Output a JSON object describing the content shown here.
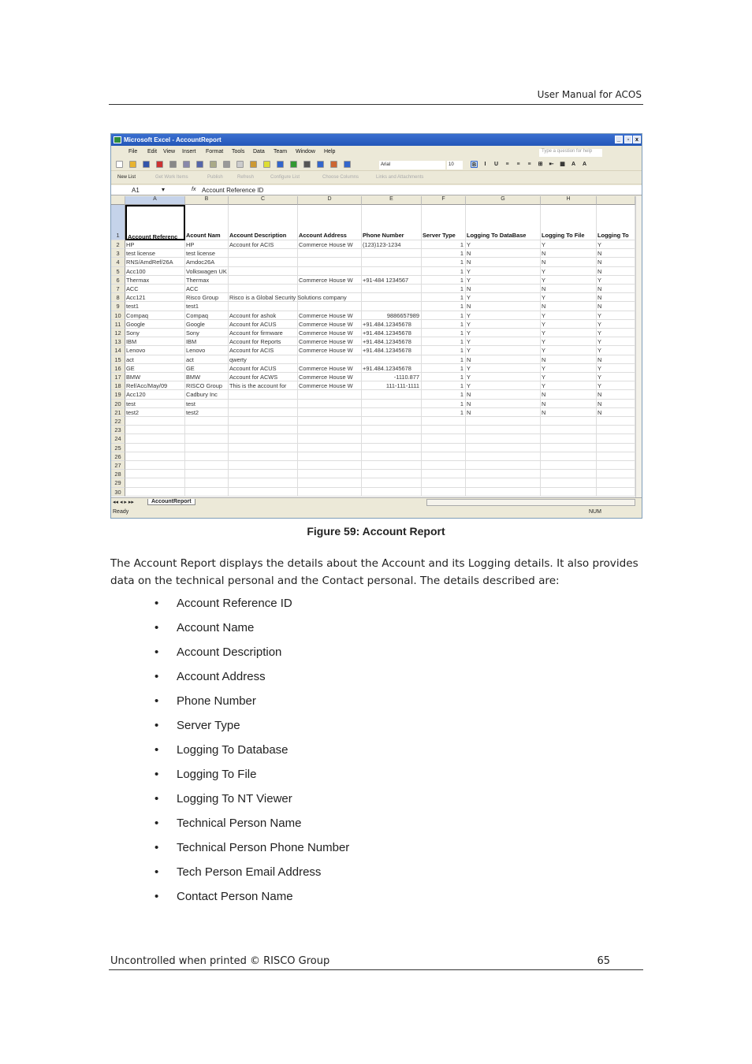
{
  "header": {
    "title": "User Manual for ACOS"
  },
  "excel": {
    "window_title": "Microsoft Excel - AccountReport",
    "window_buttons": [
      "_",
      "▫",
      "x"
    ],
    "menu": [
      "File",
      "Edit",
      "View",
      "Insert",
      "Format",
      "Tools",
      "Data",
      "Team",
      "Window",
      "Help"
    ],
    "help_placeholder": "Type a question for help",
    "font_name": "Arial",
    "font_size": "10",
    "team_toolbar": [
      "New List",
      "Get Work Items",
      "Publish",
      "Refresh",
      "Configure List",
      "Choose Columns",
      "Links and Attachments"
    ],
    "name_box": "A1",
    "formula_icon": "fx",
    "formula_value": "Account Reference ID",
    "columns": [
      "A",
      "B",
      "C",
      "D",
      "E",
      "F",
      "G",
      "H",
      ""
    ],
    "headers": [
      "Account Referenc",
      "Acount Nam",
      "Account Description",
      "Account Address",
      "Phone Number",
      "Server Type",
      "Logging To DataBase",
      "Logging To File",
      "Logging To"
    ],
    "rows": [
      [
        "HP",
        "HP",
        "Account for ACIS",
        "Commerce House W",
        "(123)123-1234",
        "1",
        "Y",
        "Y",
        "Y"
      ],
      [
        "test license",
        "test license",
        "",
        "",
        "",
        "1",
        "N",
        "N",
        "N"
      ],
      [
        "RNS/AmdRef/26A",
        "Amdoc26A",
        "",
        "",
        "",
        "1",
        "N",
        "N",
        "N"
      ],
      [
        "Acc100",
        "Volkswagen UK",
        "",
        "",
        "",
        "1",
        "Y",
        "Y",
        "N"
      ],
      [
        "Thermax",
        "Thermax",
        "",
        "Commerce House W",
        "+91-484 1234567",
        "1",
        "Y",
        "Y",
        "Y"
      ],
      [
        "ACC",
        "ACC",
        "",
        "",
        "",
        "1",
        "N",
        "N",
        "N"
      ],
      [
        "Acc121",
        "Risco Group",
        "Risco is a Global Security Solutions company",
        "",
        "",
        "1",
        "Y",
        "Y",
        "N"
      ],
      [
        "test1",
        "test1",
        "",
        "",
        "",
        "1",
        "N",
        "N",
        "N"
      ],
      [
        "Compaq",
        "Compaq",
        "Account for ashok",
        "Commerce House W",
        "9886657989",
        "1",
        "Y",
        "Y",
        "Y"
      ],
      [
        "Google",
        "Google",
        "Account for ACUS",
        "Commerce House W",
        "+91.484.12345678",
        "1",
        "Y",
        "Y",
        "Y"
      ],
      [
        "Sony",
        "Sony",
        "Account for firmware",
        "Commerce House W",
        "+91.484.12345678",
        "1",
        "Y",
        "Y",
        "Y"
      ],
      [
        "IBM",
        "IBM",
        "Account for Reports",
        "Commerce House W",
        "+91.484.12345678",
        "1",
        "Y",
        "Y",
        "Y"
      ],
      [
        "Lenovo",
        "Lenovo",
        "Account for ACIS",
        "Commerce House W",
        "+91.484.12345678",
        "1",
        "Y",
        "Y",
        "Y"
      ],
      [
        "act",
        "act",
        "qwerty",
        "",
        "",
        "1",
        "N",
        "N",
        "N"
      ],
      [
        "GE",
        "GE",
        "Account for ACUS",
        "Commerce House W",
        "+91.484.12345678",
        "1",
        "Y",
        "Y",
        "Y"
      ],
      [
        "BMW",
        "BMW",
        "Account for ACWS",
        "Commerce House W",
        "-1110.877",
        "1",
        "Y",
        "Y",
        "Y"
      ],
      [
        "Ref/Acc/May/09",
        "RISCO Group",
        "This is the account for",
        "Commerce House W",
        "111-111-1111",
        "1",
        "Y",
        "Y",
        "Y"
      ],
      [
        "Acc120",
        "Cadbury Inc",
        "",
        "",
        "",
        "1",
        "N",
        "N",
        "N"
      ],
      [
        "test",
        "test",
        "",
        "",
        "",
        "1",
        "N",
        "N",
        "N"
      ],
      [
        "test2",
        "test2",
        "",
        "",
        "",
        "1",
        "N",
        "N",
        "N"
      ]
    ],
    "total_rows": 30,
    "sheet_tab": "AccountReport",
    "status": "Ready",
    "num_indicator": "NUM"
  },
  "caption": "Figure 59: Account Report",
  "paragraph": "The Account Report displays the details about the Account and its Logging details. It also provides data on the technical personal and the Contact personal. The details described are:",
  "items": [
    "Account Reference ID",
    "Account Name",
    "Account Description",
    "Account Address",
    "Phone Number",
    "Server Type",
    "Logging To Database",
    "Logging To File",
    "Logging To NT Viewer",
    "Technical Person Name",
    "Technical Person Phone Number",
    "Tech Person Email Address",
    "Contact Person Name"
  ],
  "footer": {
    "text": "Uncontrolled when printed © RISCO Group",
    "page": "65"
  }
}
